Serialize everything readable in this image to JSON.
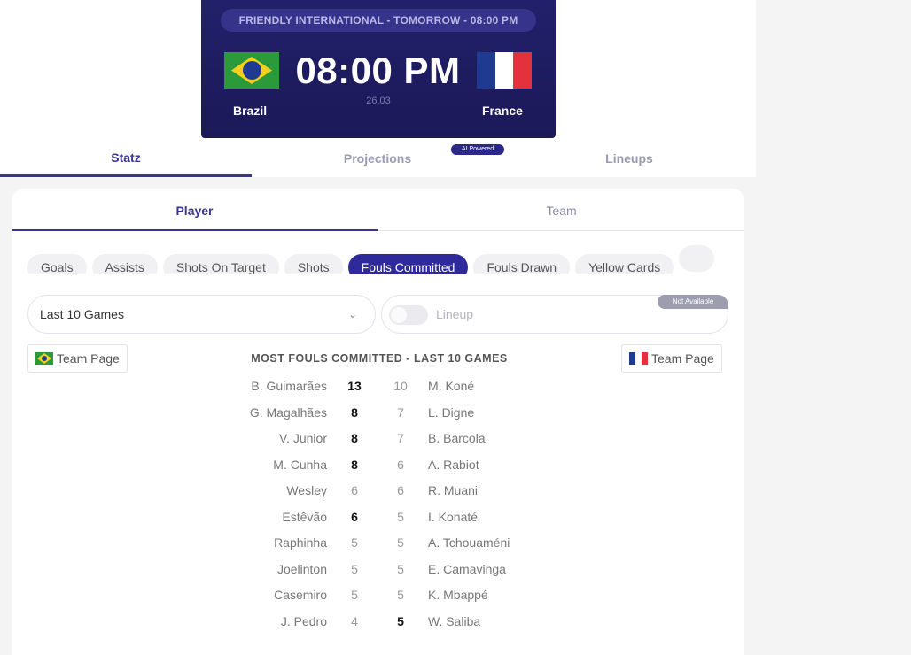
{
  "match": {
    "banner": "FRIENDLY INTERNATIONAL - TOMORROW - 08:00 PM",
    "time": "08:00 PM",
    "date": "26.03",
    "home_team": "Brazil",
    "away_team": "France"
  },
  "main_tabs": [
    {
      "label": "Statz",
      "active": true
    },
    {
      "label": "Projections",
      "active": false
    },
    {
      "label": "Lineups",
      "active": false
    }
  ],
  "ai_badge": "AI Powered",
  "sub_tabs": [
    {
      "label": "Player",
      "active": true
    },
    {
      "label": "Team",
      "active": false
    }
  ],
  "stat_chips": [
    {
      "label": "Goals",
      "active": false
    },
    {
      "label": "Assists",
      "active": false
    },
    {
      "label": "Shots On Target",
      "active": false
    },
    {
      "label": "Shots",
      "active": false
    },
    {
      "label": "Fouls Committed",
      "active": true
    },
    {
      "label": "Fouls Drawn",
      "active": false
    },
    {
      "label": "Yellow Cards",
      "active": false
    },
    {
      "label": "",
      "active": false
    }
  ],
  "filters": {
    "games_select": "Last 10 Games",
    "lineup_label": "Lineup",
    "not_available": "Not Available"
  },
  "team_page": {
    "home_label": "Team Page",
    "away_label": "Team Page"
  },
  "list_title": "MOST FOULS COMMITTED - LAST 10 GAMES",
  "rows": [
    {
      "home": "B. Guimarães",
      "home_val": "13",
      "home_bold": true,
      "away_val": "10",
      "away_bold": false,
      "away": "M. Koné"
    },
    {
      "home": "G. Magalhães",
      "home_val": "8",
      "home_bold": true,
      "away_val": "7",
      "away_bold": false,
      "away": "L. Digne"
    },
    {
      "home": "V. Junior",
      "home_val": "8",
      "home_bold": true,
      "away_val": "7",
      "away_bold": false,
      "away": "B. Barcola"
    },
    {
      "home": "M. Cunha",
      "home_val": "8",
      "home_bold": true,
      "away_val": "6",
      "away_bold": false,
      "away": "A. Rabiot"
    },
    {
      "home": "Wesley",
      "home_val": "6",
      "home_bold": false,
      "away_val": "6",
      "away_bold": false,
      "away": "R. Muani"
    },
    {
      "home": "Estêvão",
      "home_val": "6",
      "home_bold": true,
      "away_val": "5",
      "away_bold": false,
      "away": "I. Konaté"
    },
    {
      "home": "Raphinha",
      "home_val": "5",
      "home_bold": false,
      "away_val": "5",
      "away_bold": false,
      "away": "A. Tchouaméni"
    },
    {
      "home": "Joelinton",
      "home_val": "5",
      "home_bold": false,
      "away_val": "5",
      "away_bold": false,
      "away": "E. Camavinga"
    },
    {
      "home": "Casemiro",
      "home_val": "5",
      "home_bold": false,
      "away_val": "5",
      "away_bold": false,
      "away": "K. Mbappé"
    },
    {
      "home": "J. Pedro",
      "home_val": "4",
      "home_bold": false,
      "away_val": "5",
      "away_bold": true,
      "away": "W. Saliba"
    }
  ],
  "colors": {
    "accent": "#3a3595",
    "banner_bg": "#1b1958",
    "chip_active": "#2f2a9c",
    "flag_fr": [
      "#1f3b91",
      "#ffffff",
      "#e3323b"
    ]
  }
}
